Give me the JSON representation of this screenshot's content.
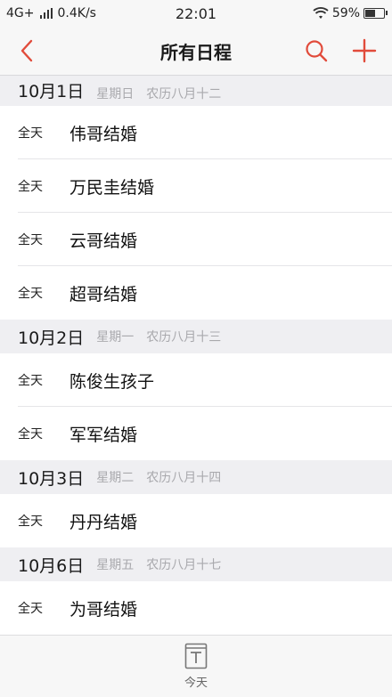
{
  "status": {
    "network": "4G+",
    "speed": "0.4K/s",
    "time": "22:01",
    "battery": "59%",
    "battery_level": 0.59
  },
  "nav": {
    "title": "所有日程",
    "accent": "#e14b3b"
  },
  "groups": [
    {
      "date": "10月1日",
      "weekday": "星期日",
      "lunar": "农历八月十二",
      "events": [
        {
          "allday": "全天",
          "title": "伟哥结婚"
        },
        {
          "allday": "全天",
          "title": "万民圭结婚"
        },
        {
          "allday": "全天",
          "title": "云哥结婚"
        },
        {
          "allday": "全天",
          "title": "超哥结婚"
        }
      ]
    },
    {
      "date": "10月2日",
      "weekday": "星期一",
      "lunar": "农历八月十三",
      "events": [
        {
          "allday": "全天",
          "title": "陈俊生孩子"
        },
        {
          "allday": "全天",
          "title": "军军结婚"
        }
      ]
    },
    {
      "date": "10月3日",
      "weekday": "星期二",
      "lunar": "农历八月十四",
      "events": [
        {
          "allday": "全天",
          "title": "丹丹结婚"
        }
      ]
    },
    {
      "date": "10月6日",
      "weekday": "星期五",
      "lunar": "农历八月十七",
      "events": [
        {
          "allday": "全天",
          "title": "为哥结婚"
        }
      ]
    }
  ],
  "tab": {
    "today_label": "今天",
    "icon": "calendar-today-icon"
  }
}
